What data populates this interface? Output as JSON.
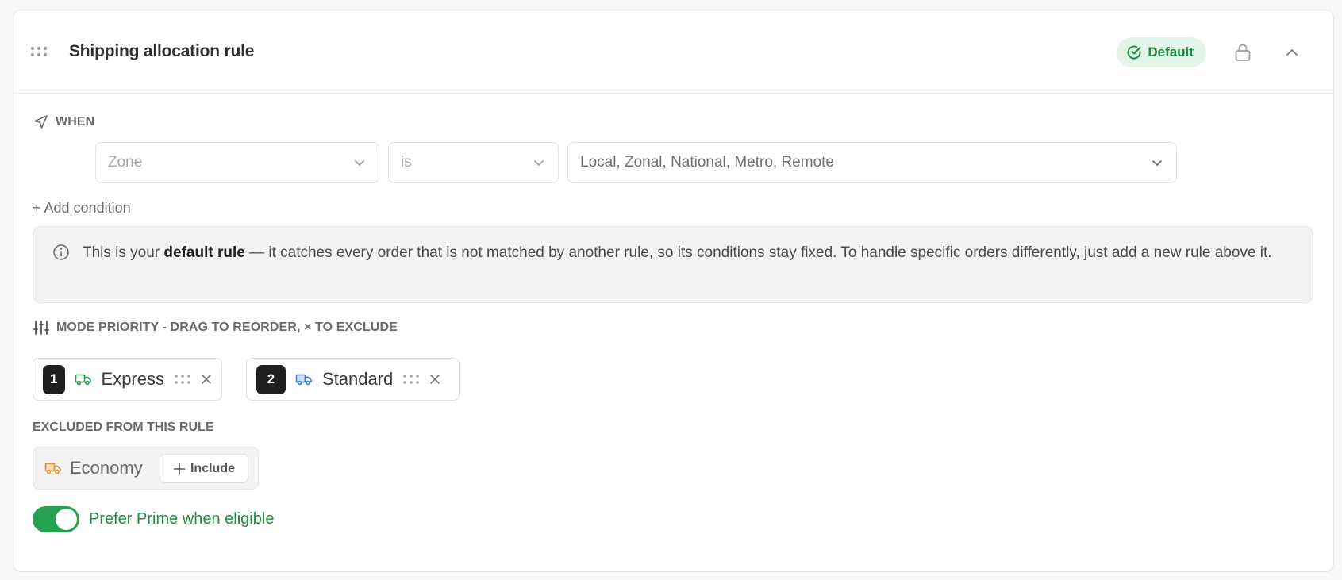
{
  "header": {
    "title": "Shipping allocation rule",
    "badge": "Default",
    "drag_icon": "drag-handle-icon",
    "lock_icon": "lock-icon",
    "collapse_icon": "chevron-up-icon"
  },
  "when": {
    "label": "WHEN",
    "field": {
      "value": "Zone"
    },
    "operator": {
      "value": "is"
    },
    "values": {
      "value": "Local, Zonal, National, Metro, Remote"
    },
    "add_condition": "+ Add condition"
  },
  "info": {
    "text_before": "This is your ",
    "text_bold": "default rule",
    "text_after": " — it catches every order that is not matched by another rule, so its conditions stay fixed. To handle specific orders differently, just add a new rule above it."
  },
  "mode_priority": {
    "label": "MODE PRIORITY - DRAG TO REORDER, × TO EXCLUDE",
    "modes": [
      {
        "rank": "1",
        "label": "Express",
        "icon": "truck-icon",
        "color": "#2e9a4a"
      },
      {
        "rank": "2",
        "label": "Standard",
        "icon": "truck-icon",
        "color": "#3f7fd0"
      }
    ]
  },
  "excluded": {
    "label": "EXCLUDED FROM THIS RULE",
    "modes": [
      {
        "label": "Economy",
        "icon": "truck-icon",
        "color": "#d9973a",
        "action": "Include"
      }
    ]
  },
  "prime": {
    "label": "Prefer Prime when eligible",
    "enabled": true
  },
  "colors": {
    "accent_green": "#27a150",
    "badge_bg": "#e3f5e8",
    "badge_text": "#1e8a3e"
  }
}
